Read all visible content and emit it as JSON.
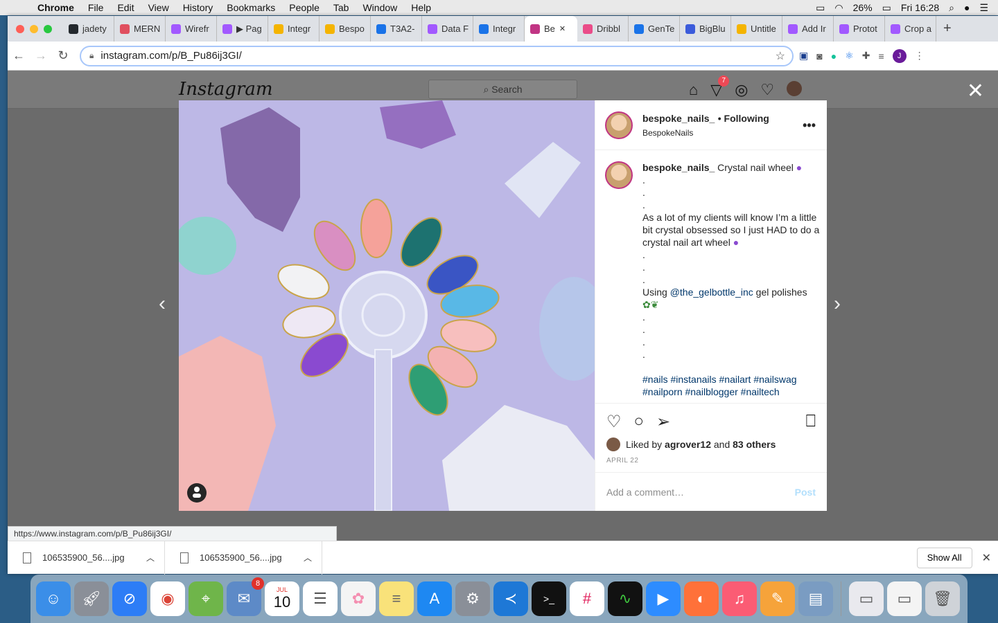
{
  "menubar": {
    "app": "Chrome",
    "items": [
      "File",
      "Edit",
      "View",
      "History",
      "Bookmarks",
      "People",
      "Tab",
      "Window",
      "Help"
    ],
    "battery": "26%",
    "clock": "Fri 16:28"
  },
  "tabs": [
    {
      "label": "jadety",
      "color": "#24292e"
    },
    {
      "label": "MERN",
      "color": "#e04f5f"
    },
    {
      "label": "Wirefr",
      "color": "#a259ff"
    },
    {
      "label": "▶ Pag",
      "color": "#a259ff"
    },
    {
      "label": "Integr",
      "color": "#f4b400"
    },
    {
      "label": "Bespo",
      "color": "#f4b400"
    },
    {
      "label": "T3A2-",
      "color": "#1a73e8"
    },
    {
      "label": "Data F",
      "color": "#a259ff"
    },
    {
      "label": "Integr",
      "color": "#1a73e8"
    },
    {
      "label": "Be",
      "color": "#c13584",
      "active": true
    },
    {
      "label": "Dribbl",
      "color": "#ea4c89"
    },
    {
      "label": "GenTe",
      "color": "#1a73e8"
    },
    {
      "label": "BigBlu",
      "color": "#3b5bdb"
    },
    {
      "label": "Untitle",
      "color": "#f4b400"
    },
    {
      "label": "Add Ir",
      "color": "#a259ff"
    },
    {
      "label": "Protot",
      "color": "#a259ff"
    },
    {
      "label": "Crop a",
      "color": "#a259ff"
    }
  ],
  "toolbar": {
    "url": "instagram.com/p/B_Pu86ij3GI/"
  },
  "instagram": {
    "logo": "Instagram",
    "search_placeholder": "Search",
    "notif_count": "7"
  },
  "post": {
    "username": "bespoke_nails_",
    "following": "• Following",
    "location": "BespokeNails",
    "caption_title": "Crystal nail wheel",
    "caption_body": "As a lot of my clients will know I’m a little bit crystal obsessed so I just HAD to do a crystal nail art wheel",
    "using_prefix": "Using",
    "mention": "@the_gelbottle_inc",
    "using_suffix": "gel polishes",
    "hashtags_1": "#nails #instanails #nailart #nailswag",
    "hashtags_2": "#nailporn #nailblogger #nailtech",
    "liked_by_prefix": "Liked by",
    "liked_user": "agrover12",
    "liked_and": "and",
    "liked_others": "83 others",
    "date": "APRIL 22",
    "comment_placeholder": "Add a comment…",
    "post_button": "Post"
  },
  "status_url": "https://www.instagram.com/p/B_Pu86ij3GI/",
  "downloads": {
    "items": [
      "106535900_56....jpg",
      "106535900_56....jpg"
    ],
    "show_all": "Show All"
  },
  "dock": {
    "calendar_month": "JUL",
    "calendar_day": "10",
    "mail_badge": "8"
  }
}
